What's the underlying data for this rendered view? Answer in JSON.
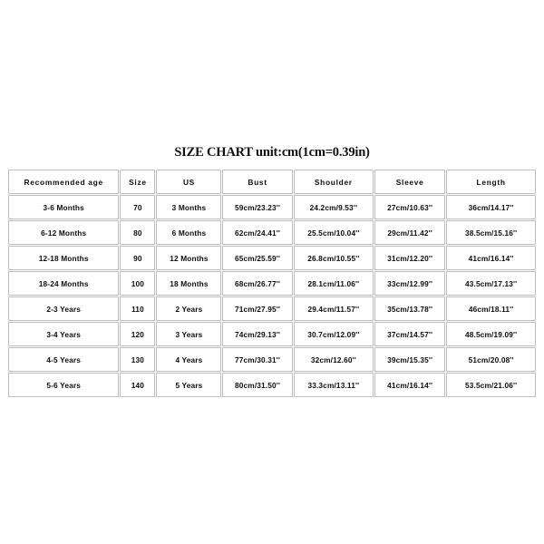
{
  "title": "SIZE CHART unit:cm(1cm=0.39in)",
  "table": {
    "columns": [
      "Recommended age",
      "Size",
      "US",
      "Bust",
      "Shoulder",
      "Sleeve",
      "Length"
    ],
    "rows": [
      [
        "3-6 Months",
        "70",
        "3 Months",
        "59cm/23.23''",
        "24.2cm/9.53''",
        "27cm/10.63''",
        "36cm/14.17''"
      ],
      [
        "6-12 Months",
        "80",
        "6 Months",
        "62cm/24.41''",
        "25.5cm/10.04''",
        "29cm/11.42''",
        "38.5cm/15.16''"
      ],
      [
        "12-18 Months",
        "90",
        "12 Months",
        "65cm/25.59''",
        "26.8cm/10.55''",
        "31cm/12.20''",
        "41cm/16.14''"
      ],
      [
        "18-24 Months",
        "100",
        "18 Months",
        "68cm/26.77''",
        "28.1cm/11.06''",
        "33cm/12.99''",
        "43.5cm/17.13''"
      ],
      [
        "2-3 Years",
        "110",
        "2 Years",
        "71cm/27.95''",
        "29.4cm/11.57''",
        "35cm/13.78''",
        "46cm/18.11''"
      ],
      [
        "3-4 Years",
        "120",
        "3 Years",
        "74cm/29.13''",
        "30.7cm/12.09''",
        "37cm/14.57''",
        "48.5cm/19.09''"
      ],
      [
        "4-5 Years",
        "130",
        "4 Years",
        "77cm/30.31''",
        "32cm/12.60''",
        "39cm/15.35''",
        "51cm/20.08''"
      ],
      [
        "5-6 Years",
        "140",
        "5 Years",
        "80cm/31.50''",
        "33.3cm/13.11''",
        "41cm/16.14''",
        "53.5cm/21.06''"
      ]
    ]
  },
  "colors": {
    "background": "#ffffff",
    "cell_background": "#ffffff",
    "border": "#bdbdbd",
    "text": "#0d0d0d"
  }
}
